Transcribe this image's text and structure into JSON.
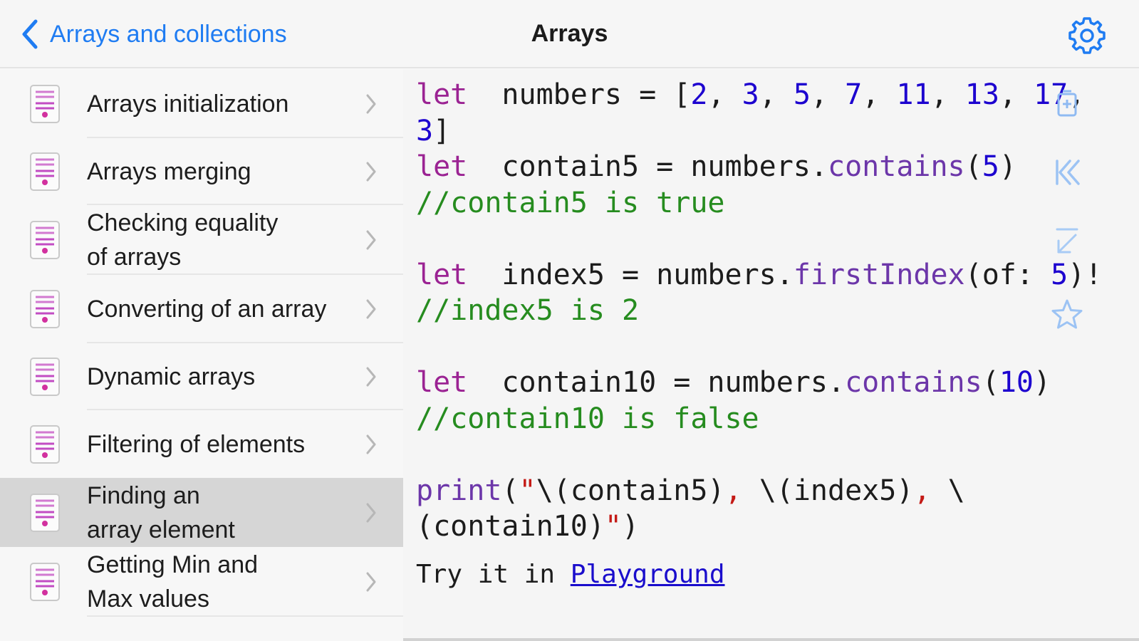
{
  "navbar": {
    "back_label": "Arrays and collections",
    "title": "Arrays",
    "back_icon": "chevron-left-icon",
    "settings_icon": "gear-icon"
  },
  "sidebar": {
    "items": [
      {
        "lines": [
          "Arrays initialization"
        ],
        "icon": "code-file-icon"
      },
      {
        "lines": [
          "Arrays merging"
        ],
        "icon": "code-file-icon"
      },
      {
        "lines": [
          "Checking equality",
          "of arrays"
        ],
        "icon": "code-file-icon"
      },
      {
        "lines": [
          "Converting of an array"
        ],
        "icon": "code-file-icon"
      },
      {
        "lines": [
          "Dynamic arrays"
        ],
        "icon": "code-file-icon"
      },
      {
        "lines": [
          "Filtering of elements"
        ],
        "icon": "code-file-icon"
      },
      {
        "lines": [
          "Finding an",
          "array element"
        ],
        "icon": "code-file-icon",
        "selected": true
      },
      {
        "lines": [
          "Getting Min and",
          "Max values"
        ],
        "icon": "code-file-icon"
      }
    ]
  },
  "code": {
    "lines": [
      [
        [
          "kw",
          "let"
        ],
        [
          "",
          "  numbers = ["
        ],
        [
          "num",
          "2"
        ],
        [
          "",
          ", "
        ],
        [
          "num",
          "3"
        ],
        [
          "",
          ", "
        ],
        [
          "num",
          "5"
        ],
        [
          "",
          ", "
        ],
        [
          "num",
          "7"
        ],
        [
          "",
          ", "
        ],
        [
          "num",
          "11"
        ],
        [
          "",
          ", "
        ],
        [
          "num",
          "13"
        ],
        [
          "",
          ", "
        ],
        [
          "num",
          "17"
        ],
        [
          "",
          ","
        ]
      ],
      [
        [
          "num",
          "3"
        ],
        [
          "",
          "]"
        ]
      ],
      [
        [
          "kw",
          "let"
        ],
        [
          "",
          "  contain5 = numbers."
        ],
        [
          "fn",
          "contains"
        ],
        [
          "",
          "("
        ],
        [
          "num",
          "5"
        ],
        [
          "",
          ")"
        ]
      ],
      [
        [
          "cm",
          "//contain5 is true"
        ]
      ],
      [
        [
          "",
          ""
        ]
      ],
      [
        [
          "kw",
          "let"
        ],
        [
          "",
          "  index5 = numbers."
        ],
        [
          "fn",
          "firstIndex"
        ],
        [
          "",
          "(of: "
        ],
        [
          "num",
          "5"
        ],
        [
          "",
          ")!"
        ]
      ],
      [
        [
          "cm",
          "//index5 is 2"
        ]
      ],
      [
        [
          "",
          ""
        ]
      ],
      [
        [
          "kw",
          "let"
        ],
        [
          "",
          "  contain10 = numbers."
        ],
        [
          "fn",
          "contains"
        ],
        [
          "",
          "("
        ],
        [
          "num",
          "10"
        ],
        [
          "",
          ")"
        ]
      ],
      [
        [
          "cm",
          "//contain10 is false"
        ]
      ],
      [
        [
          "",
          ""
        ]
      ],
      [
        [
          "fn",
          "print"
        ],
        [
          "",
          "("
        ],
        [
          "str",
          "\""
        ],
        [
          "",
          "\\(contain5)"
        ],
        [
          "str",
          ", "
        ],
        [
          "",
          "\\(index5)"
        ],
        [
          "str",
          ", "
        ],
        [
          "",
          "\\"
        ]
      ],
      [
        [
          "",
          "(contain10)"
        ],
        [
          "str",
          "\""
        ],
        [
          "",
          ")"
        ]
      ]
    ]
  },
  "footer": {
    "try_prefix": "Try it in ",
    "playground_link": "Playground"
  },
  "toolbar": {
    "icons": [
      "copy-icon",
      "skip-back-icon",
      "collapse-icon",
      "star-icon"
    ]
  },
  "colors": {
    "accent": "#1f7cf2",
    "keyword": "#9b2393",
    "number": "#1c00cf",
    "function": "#6c36a9",
    "comment": "#268c1f",
    "string": "#c41a16",
    "selected_row": "#d6d6d6"
  }
}
